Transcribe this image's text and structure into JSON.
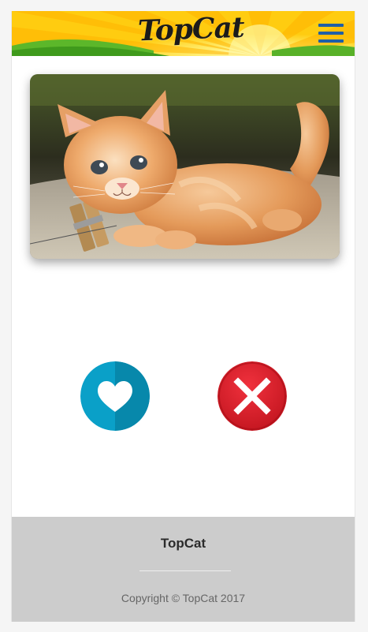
{
  "header": {
    "logo_text": "TopCat",
    "menu_icon": "hamburger-menu-icon"
  },
  "photo": {
    "subject": "orange tabby kitten"
  },
  "actions": {
    "like_icon": "heart-icon",
    "nope_icon": "close-icon",
    "colors": {
      "like": "#0aa0c8",
      "nope": "#d8222e"
    }
  },
  "footer": {
    "title": "TopCat",
    "copyright": "Copyright © TopCat 2017"
  },
  "colors": {
    "footer_bg": "#cccccc",
    "menu_icon": "#1f5fa6",
    "header_yellow": "#ffcc10",
    "header_green": "#49a520"
  }
}
